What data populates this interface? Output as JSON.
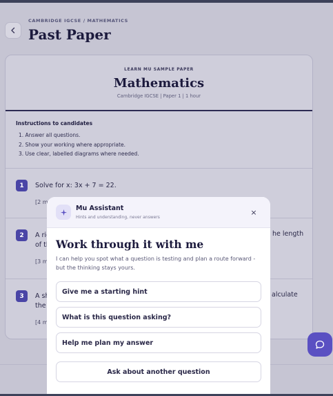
{
  "header": {
    "breadcrumb": "CAMBRIDGE IGCSE / MATHEMATICS",
    "title": "Past Paper",
    "back_icon": "chevron-left-icon"
  },
  "paper": {
    "kicker": "LEARN MU SAMPLE PAPER",
    "title": "Mathematics",
    "subtitle": "Cambridge IGCSE | Paper 1 | 1 hour",
    "instructions": {
      "title": "Instructions to candidates",
      "items": [
        "1. Answer all questions.",
        "2. Show your working where appropriate.",
        "3. Use clear, labelled diagrams where needed."
      ]
    },
    "questions": [
      {
        "number": "1",
        "text": "Solve for x: 3x + 7 = 22.",
        "marks": "[2 ma"
      },
      {
        "number": "2",
        "text_line1": "A rig",
        "text_line2": "of th",
        "text_right": "he length",
        "marks": "[3 m"
      },
      {
        "number": "3",
        "text_line1": "A sh",
        "text_line2": "the",
        "text_right": "alculate",
        "marks": "[4 m"
      }
    ]
  },
  "assistant": {
    "icon": "sparkle-icon",
    "name": "Mu Assistant",
    "tagline": "Hints and understanding, never answers",
    "close": "×",
    "heading": "Work through it with me",
    "description": "I can help you spot what a question is testing and plan a route forward - but the thinking stays yours.",
    "options": [
      "Give me a starting hint",
      "What is this question asking?",
      "Help me plan my answer"
    ],
    "secondary": "Ask about another question"
  },
  "fab": {
    "icon": "chat-bubble-icon"
  },
  "colors": {
    "accent": "#5a50c2",
    "question_badge": "#4a45a6",
    "backdrop": "#c6c5d3",
    "ink": "#1c1a3d"
  }
}
